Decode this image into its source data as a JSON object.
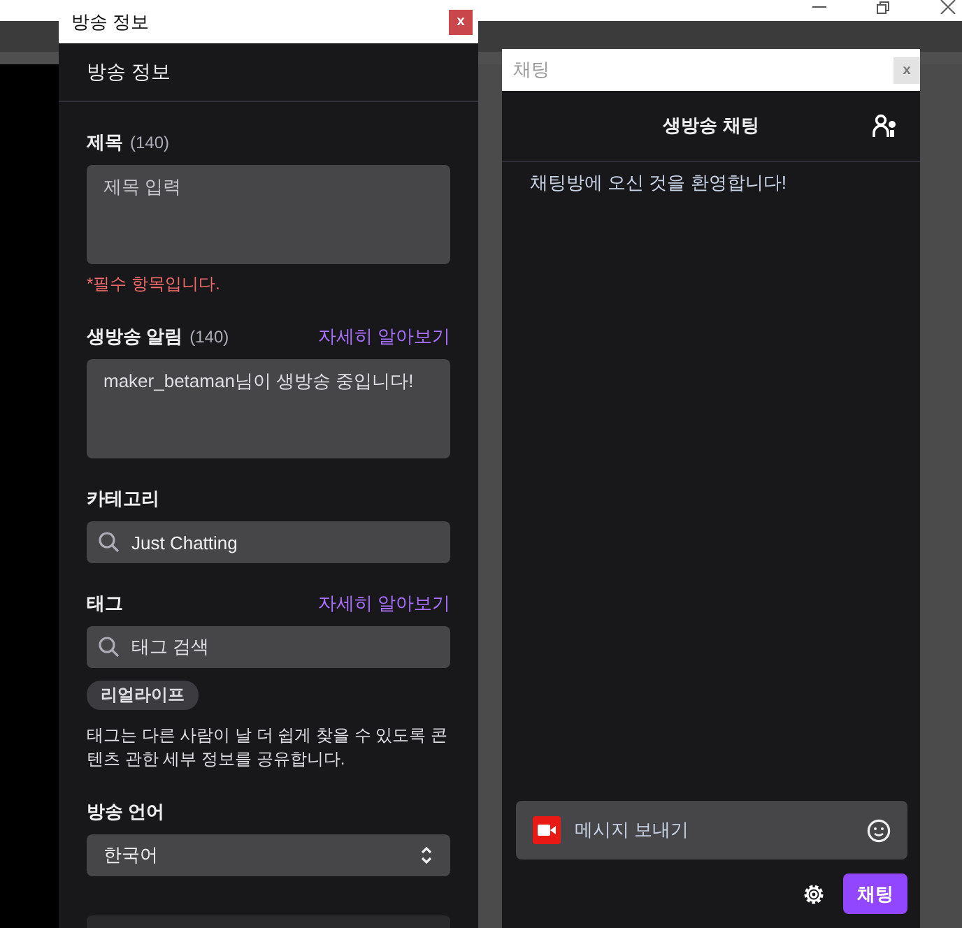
{
  "info_window": {
    "title": "방송 정보",
    "close": "x",
    "heading": "방송 정보",
    "title_field": {
      "label": "제목",
      "count": "(140)",
      "placeholder": "제목 입력",
      "error": "*필수 항목입니다."
    },
    "notification_field": {
      "label": "생방송 알림",
      "count": "(140)",
      "link": "자세히 알아보기",
      "value": "maker_betaman님이 생방송 중입니다!"
    },
    "category": {
      "label": "카테고리",
      "value": "Just Chatting"
    },
    "tags": {
      "label": "태그",
      "link": "자세히 알아보기",
      "placeholder": "태그 검색",
      "chips": [
        "리얼라이프"
      ],
      "help": "태그는 다른 사람이 날 더 쉽게 찾을 수 있도록 콘텐츠 관한 세부 정보를 공유합니다."
    },
    "language": {
      "label": "방송 언어",
      "value": "한국어"
    }
  },
  "chat_window": {
    "title": "채팅",
    "close": "x",
    "heading": "생방송 채팅",
    "messages": [
      "채팅방에 오신 것을 환영합니다!"
    ],
    "input": {
      "placeholder": "메시지 보내기"
    },
    "send_button": "채팅"
  }
}
